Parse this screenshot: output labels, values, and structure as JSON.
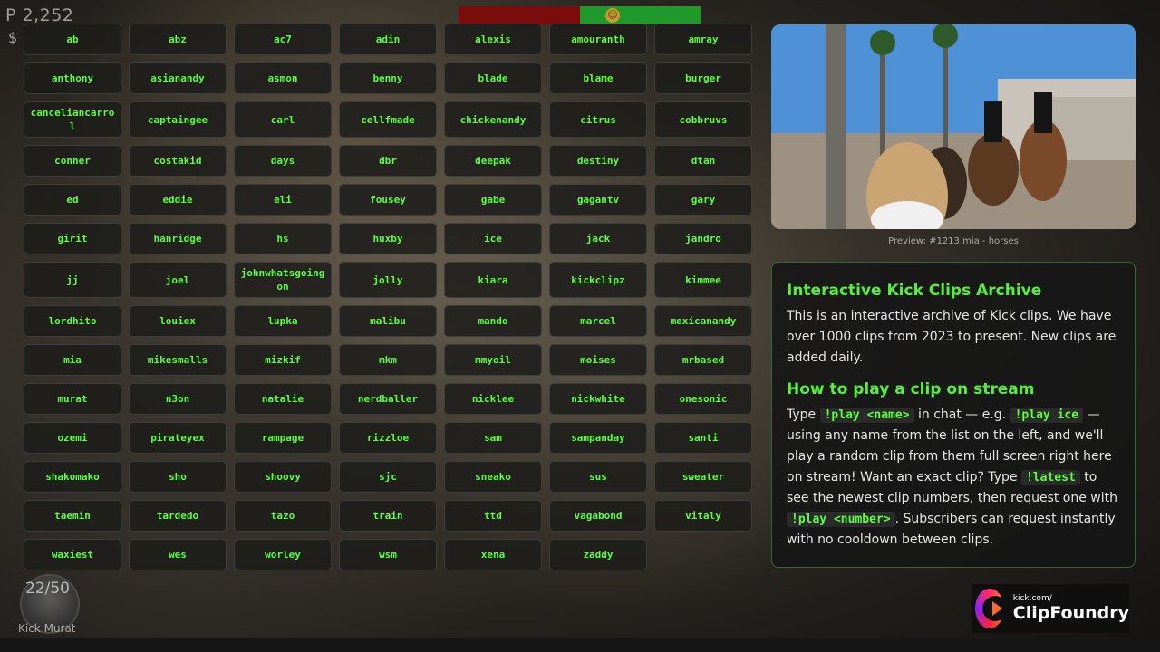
{
  "top_stats": {
    "points": "P 2,252",
    "currency": "$"
  },
  "vote": {
    "emoji": "☺"
  },
  "names": [
    "ab",
    "abz",
    "ac7",
    "adin",
    "alexis",
    "amouranth",
    "amray",
    "anthony",
    "asianandy",
    "asmon",
    "benny",
    "blade",
    "blame",
    "burger",
    "canceliancarrol",
    "captaingee",
    "carl",
    "cellfmade",
    "chickenandy",
    "citrus",
    "cobbruvs",
    "conner",
    "costakid",
    "days",
    "dbr",
    "deepak",
    "destiny",
    "dtan",
    "ed",
    "eddie",
    "eli",
    "fousey",
    "gabe",
    "gagantv",
    "gary",
    "girit",
    "hanridge",
    "hs",
    "huxby",
    "ice",
    "jack",
    "jandro",
    "jj",
    "joel",
    "johnwhatsgoingon",
    "jolly",
    "kiara",
    "kickclipz",
    "kimmee",
    "lordhito",
    "louiex",
    "lupka",
    "malibu",
    "mando",
    "marcel",
    "mexicanandy",
    "mia",
    "mikesmalls",
    "mizkif",
    "mkm",
    "mmyoil",
    "moises",
    "mrbased",
    "murat",
    "n3on",
    "natalie",
    "nerdballer",
    "nicklee",
    "nickwhite",
    "onesonic",
    "ozemi",
    "pirateyex",
    "rampage",
    "rizzloe",
    "sam",
    "sampanday",
    "santi",
    "shakomako",
    "sho",
    "shoovy",
    "sjc",
    "sneako",
    "sus",
    "sweater",
    "taemin",
    "tardedo",
    "tazo",
    "train",
    "ttd",
    "vagabond",
    "vitaly",
    "waxiest",
    "wes",
    "worley",
    "wsm",
    "xena",
    "zaddy"
  ],
  "avatar": {
    "progress": "22/50",
    "label": "Kick Murat"
  },
  "preview": {
    "caption": "Preview: #1213 mia - horses"
  },
  "info": {
    "title": "Interactive Kick Clips Archive",
    "description": "This is an interactive archive of Kick clips. We have over 1000 clips from 2023 to present. New clips are added daily.",
    "how_title": "How to play a clip on stream",
    "how": {
      "t1": "Type ",
      "c1": "!play <name>",
      "t2": " in chat — e.g. ",
      "c2": "!play ice",
      "t3": " — using any name from the list on the left, and we'll play a random clip from them full screen right here on stream! Want an exact clip? Type ",
      "c3": "!latest",
      "t4": " to see the newest clip numbers, then request one with ",
      "c4": "!play <number>",
      "t5": ". Subscribers can request instantly with no cooldown between clips."
    }
  },
  "logo": {
    "domain": "kick.com/",
    "name": "ClipFoundry"
  },
  "colors": {
    "accent": "#5cff3e",
    "vote_no": "#7a0c0c",
    "vote_yes": "#1f9a2a"
  }
}
